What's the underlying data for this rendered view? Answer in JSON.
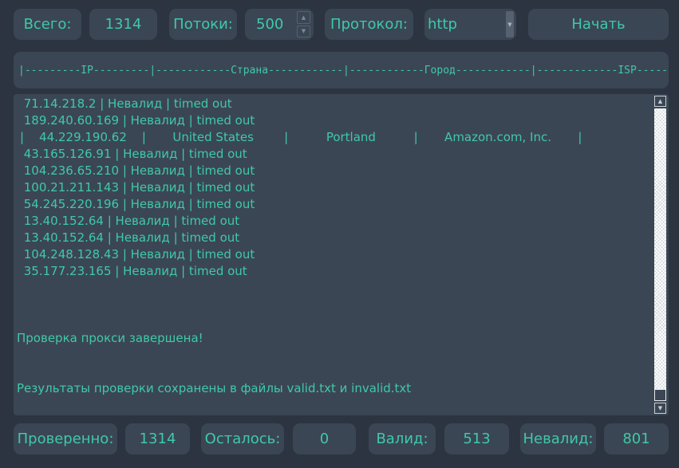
{
  "top": {
    "total_label": "Всего:",
    "total_value": "1314",
    "threads_label": "Потоки:",
    "threads_value": "500",
    "protocol_label": "Протокол:",
    "protocol_value": "http",
    "start_button": "Начать"
  },
  "header": {
    "columns_line": "|---------IP---------|------------Страна------------|------------Город------------|-------------ISP-------------|"
  },
  "log": {
    "lines": [
      " 71.14.218.2 | Невалид | timed out",
      " 189.240.60.169 | Невалид | timed out",
      "|    44.229.190.62    |       United States        |          Portland          |       Amazon.com, Inc.       |",
      " 43.165.126.91 | Невалид | timed out",
      " 104.236.65.210 | Невалид | timed out",
      " 100.21.211.143 | Невалид | timed out",
      " 54.245.220.196 | Невалид | timed out",
      " 13.40.152.64 | Невалид | timed out",
      " 13.40.152.64 | Невалид | timed out",
      " 104.248.128.43 | Невалид | timed out",
      " 35.177.23.165 | Невалид | timed out"
    ],
    "done_message": "Проверка прокси завершена!",
    "saved_message": "Результаты проверки сохранены в файлы valid.txt и invalid.txt"
  },
  "bottom": {
    "checked_label": "Проверенно:",
    "checked_value": "1314",
    "remaining_label": "Осталось:",
    "remaining_value": "0",
    "valid_label": "Валид:",
    "valid_value": "513",
    "invalid_label": "Невалид:",
    "invalid_value": "801"
  },
  "icons": {
    "up": "▲",
    "down": "▼"
  },
  "colors": {
    "background": "#2b3440",
    "panel": "#3b4654",
    "accent_text": "#3fc9a8"
  }
}
